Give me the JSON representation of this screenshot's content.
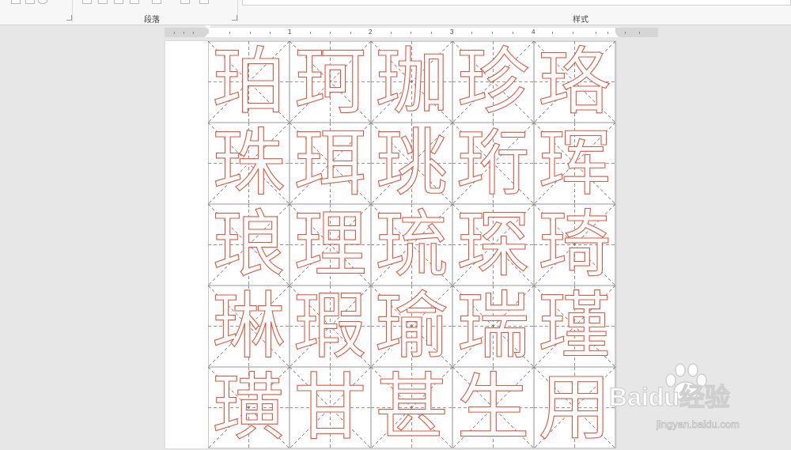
{
  "ribbon": {
    "paragraph_group_label": "段落",
    "styles_group_label": "样式"
  },
  "ruler": {
    "numbers": [
      "1",
      "2",
      "3",
      "4"
    ]
  },
  "document": {
    "characters": [
      [
        "珀",
        "珂",
        "珈",
        "珍",
        "珞"
      ],
      [
        "珠",
        "珥",
        "珧",
        "珩",
        "珲"
      ],
      [
        "琅",
        "理",
        "琉",
        "琛",
        "琦"
      ],
      [
        "琳",
        "瑕",
        "瑜",
        "瑞",
        "瑾"
      ],
      [
        "璜",
        "甘",
        "甚",
        "生",
        "用"
      ]
    ],
    "glyph_stroke_color": "#e0573f",
    "grid_line_color": "#777777"
  },
  "watermark": {
    "text": "Baidu经验",
    "url": "jingyan.baidu.com"
  }
}
